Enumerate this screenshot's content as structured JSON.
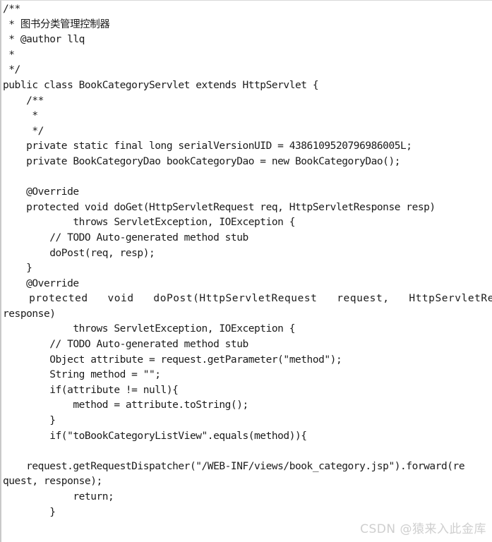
{
  "window": {
    "kind": "code-snippet-screenshot",
    "background_color": "#ffffff",
    "text_color": "#1b1b1b",
    "border_color": "#c9c9c9"
  },
  "code": {
    "language": "java",
    "class_name": "BookCategoryServlet",
    "lines": [
      {
        "text": "/**",
        "wide": false
      },
      {
        "text": " * 图书分类管理控制器",
        "wide": false
      },
      {
        "text": " * @author llq",
        "wide": false
      },
      {
        "text": " *",
        "wide": false
      },
      {
        "text": " */",
        "wide": false
      },
      {
        "text": "public class BookCategoryServlet extends HttpServlet {",
        "wide": false
      },
      {
        "text": "    /**",
        "wide": false
      },
      {
        "text": "     *",
        "wide": false
      },
      {
        "text": "     */",
        "wide": false
      },
      {
        "text": "    private static final long serialVersionUID = 4386109520796986005L;",
        "wide": false
      },
      {
        "text": "    private BookCategoryDao bookCategoryDao = new BookCategoryDao();",
        "wide": false
      },
      {
        "text": "",
        "wide": false
      },
      {
        "text": "    @Override",
        "wide": false
      },
      {
        "text": "    protected void doGet(HttpServletRequest req, HttpServletResponse resp)",
        "wide": false
      },
      {
        "text": "            throws ServletException, IOException {",
        "wide": false
      },
      {
        "text": "        // TODO Auto-generated method stub",
        "wide": false
      },
      {
        "text": "        doPost(req, resp);",
        "wide": false
      },
      {
        "text": "    }",
        "wide": false
      },
      {
        "text": "    @Override",
        "wide": false
      },
      {
        "text": "    protected   void   doPost(HttpServletRequest   request,   HttpServletResponse",
        "wide": true
      },
      {
        "text": "response)",
        "wide": false
      },
      {
        "text": "            throws ServletException, IOException {",
        "wide": false
      },
      {
        "text": "        // TODO Auto-generated method stub",
        "wide": false
      },
      {
        "text": "        Object attribute = request.getParameter(\"method\");",
        "wide": false
      },
      {
        "text": "        String method = \"\";",
        "wide": false
      },
      {
        "text": "        if(attribute != null){",
        "wide": false
      },
      {
        "text": "            method = attribute.toString();",
        "wide": false
      },
      {
        "text": "        }",
        "wide": false
      },
      {
        "text": "        if(\"toBookCategoryListView\".equals(method)){",
        "wide": false
      },
      {
        "text": "",
        "wide": false
      },
      {
        "text": "    request.getRequestDispatcher(\"/WEB-INF/views/book_category.jsp\").forward(re",
        "wide": false
      },
      {
        "text": "quest, response);",
        "wide": false
      },
      {
        "text": "            return;",
        "wide": false
      },
      {
        "text": "        }",
        "wide": false
      }
    ]
  },
  "watermark": {
    "text": "CSDN @猿来入此金库",
    "color": "#cfcfcf"
  }
}
